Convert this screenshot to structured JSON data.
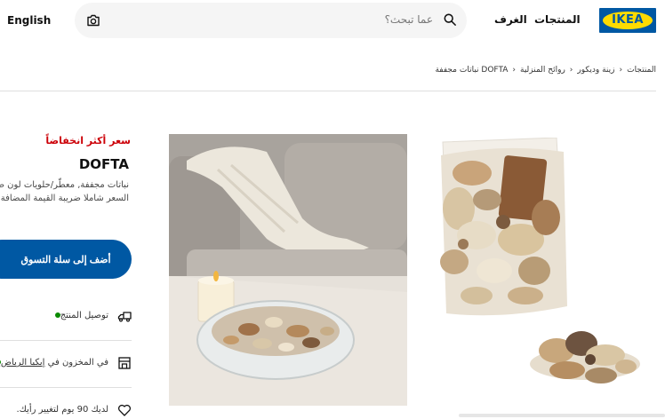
{
  "header": {
    "logo_text": "IKEA",
    "nav": {
      "products": "المنتجات",
      "rooms": "الغرف"
    },
    "search": {
      "placeholder": "عما تبحث؟"
    },
    "language": "English"
  },
  "breadcrumb": [
    "المنتجات",
    "زينة وديكور",
    "روائح المنزلية",
    "DOFTA نباتات مجففة"
  ],
  "product": {
    "price_tag": "سعر أكثر انخفاضاً",
    "name": "DOFTA",
    "description": "نباتات مجففة, معطّر/حلويات لون طبيعي",
    "vat_note": "السعر شاملا ضريبة القيمة المضافة",
    "add_to_cart": "أضف إلى سلة التسوق",
    "delivery": "توصيل المنتج",
    "stock_prefix": "في المخزون في",
    "stock_store": "إيكيا الرياض",
    "return": "لديك 90 يوم لتغيير رأيك."
  },
  "colors": {
    "ikea_blue": "#0058a3",
    "ikea_yellow": "#ffdb00",
    "sale_red": "#cc0008",
    "in_stock_green": "#0a8a00"
  }
}
